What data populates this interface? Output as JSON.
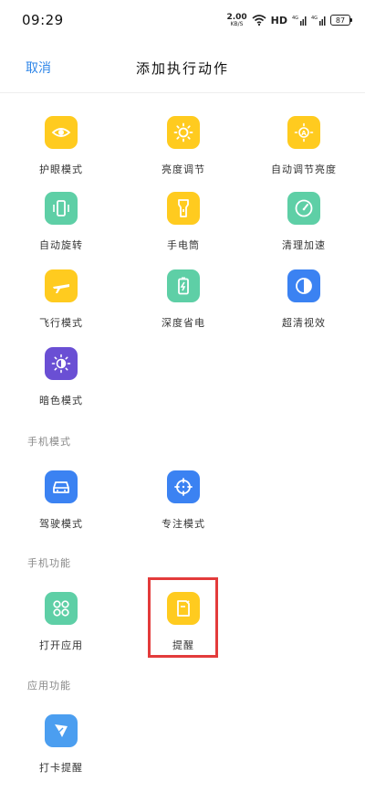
{
  "status": {
    "time": "09:29",
    "speed_value": "2.00",
    "speed_unit": "KB/S",
    "hd": "HD",
    "battery": "87",
    "net1": "4G",
    "net2": "4G"
  },
  "header": {
    "cancel": "取消",
    "title": "添加执行动作"
  },
  "section_main": {
    "items": [
      {
        "label": "护眼模式",
        "icon": "eye-icon"
      },
      {
        "label": "亮度调节",
        "icon": "sun-icon"
      },
      {
        "label": "自动调节亮度",
        "icon": "auto-brightness-icon"
      },
      {
        "label": "自动旋转",
        "icon": "rotate-icon"
      },
      {
        "label": "手电筒",
        "icon": "flashlight-icon"
      },
      {
        "label": "清理加速",
        "icon": "speedometer-icon"
      },
      {
        "label": "飞行模式",
        "icon": "airplane-icon"
      },
      {
        "label": "深度省电",
        "icon": "battery-saver-icon"
      },
      {
        "label": "超清视效",
        "icon": "contrast-icon"
      },
      {
        "label": "暗色模式",
        "icon": "dark-mode-icon"
      }
    ]
  },
  "section_phone_mode": {
    "label": "手机模式",
    "items": [
      {
        "label": "驾驶模式",
        "icon": "car-icon"
      },
      {
        "label": "专注模式",
        "icon": "target-icon"
      }
    ]
  },
  "section_phone_func": {
    "label": "手机功能",
    "items": [
      {
        "label": "打开应用",
        "icon": "apps-icon"
      },
      {
        "label": "提醒",
        "icon": "note-icon"
      }
    ]
  },
  "section_app_func": {
    "label": "应用功能",
    "items": [
      {
        "label": "打卡提醒",
        "icon": "checkin-icon"
      }
    ]
  },
  "colors": {
    "yellow": "#ffcb1f",
    "green": "#5ecfa6",
    "blue": "#3b82f2",
    "purple": "#6a4fd4",
    "azure": "#4b9ef0",
    "accent": "#2f86e8",
    "highlight": "#e33b3b"
  }
}
